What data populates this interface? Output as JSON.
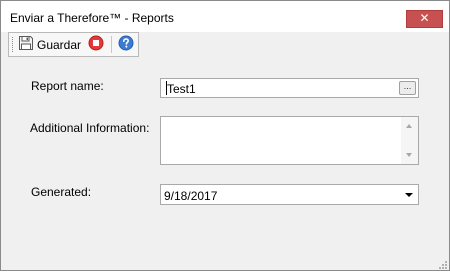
{
  "window": {
    "title": "Enviar a Therefore™ - Reports",
    "close_glyph": "✕"
  },
  "toolbar": {
    "save_label": "Guardar",
    "save_icon": "save-icon",
    "stop_icon": "stop-icon",
    "help_icon": "help-icon"
  },
  "form": {
    "report_name_label": "Report name:",
    "report_name_value": "Test1",
    "browse_label": "...",
    "additional_info_label": "Additional Information:",
    "additional_info_value": "",
    "generated_label": "Generated:",
    "generated_value": "9/18/2017"
  },
  "colors": {
    "close_button": "#c75050",
    "stop_icon": "#e03a3a",
    "help_icon": "#3b7bd4",
    "window_bg": "#f0f0f0"
  }
}
